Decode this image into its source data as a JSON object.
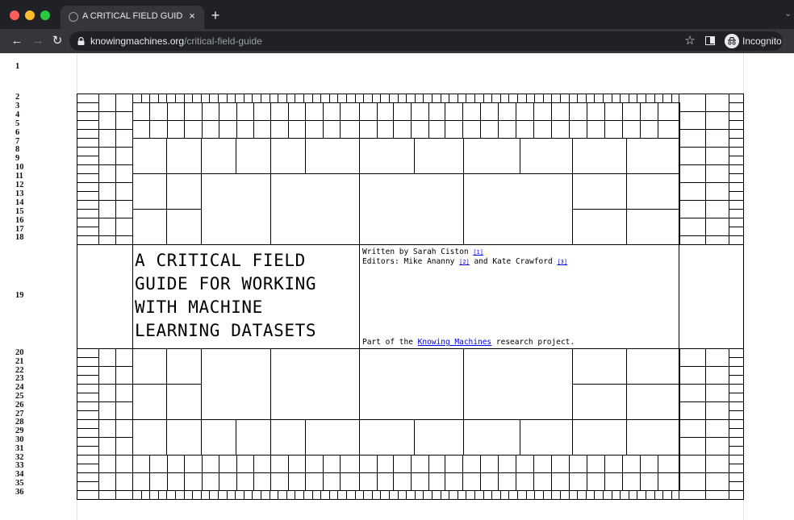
{
  "browser": {
    "tab_title": "A CRITICAL FIELD GUIDE FOR W",
    "tab_close": "×",
    "new_tab": "+",
    "url_host": "knowingmachines.org",
    "url_path": "/critical-field-guide",
    "incognito_label": "Incognito",
    "colors": {
      "close": "#ff5f57",
      "minimize": "#febc2e",
      "maximize": "#28c840"
    }
  },
  "page": {
    "row_numbers": [
      "1",
      "2",
      "3",
      "4",
      "5",
      "6",
      "7",
      "8",
      "9",
      "10",
      "11",
      "12",
      "13",
      "14",
      "15",
      "16",
      "17",
      "18",
      "19",
      "20",
      "21",
      "22",
      "23",
      "24",
      "25",
      "26",
      "27",
      "28",
      "29",
      "30",
      "31",
      "32",
      "33",
      "34",
      "35",
      "36"
    ],
    "title": "A CRITICAL FIELD GUIDE FOR WORKING WITH MACHINE LEARNING DATASETS",
    "title_lines": [
      "A CRITICAL FIELD",
      "GUIDE FOR WORKING",
      "WITH MACHINE",
      "LEARNING DATASETS"
    ],
    "byline": {
      "prefix": "Written by Sarah Ciston ",
      "ref1": "[1]",
      "editors_prefix": "Editors: Mike Ananny ",
      "ref2": "[2]",
      "editors_and": " and Kate Crawford ",
      "ref3": "[3]"
    },
    "footer": {
      "prefix": "Part of the ",
      "link": "Knowing Machines",
      "suffix": " research project."
    }
  }
}
